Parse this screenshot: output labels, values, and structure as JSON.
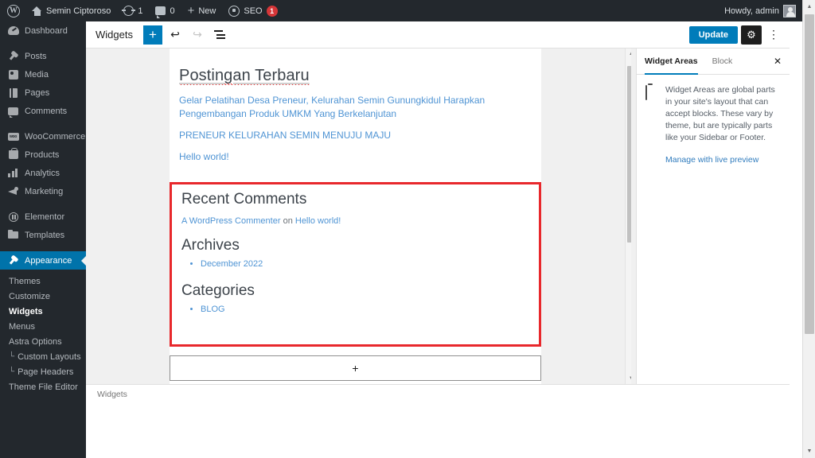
{
  "adminbar": {
    "logo_icon": "wordpress-logo-icon",
    "site_icon": "home-icon",
    "site_name": "Semin Ciptoroso",
    "updates_icon": "updates-icon",
    "updates_count": "1",
    "comments_icon": "comment-bubble-icon",
    "comments_count": "0",
    "new_icon": "plus-icon",
    "new_label": "New",
    "seo_icon": "seo-gear-icon",
    "seo_label": "SEO",
    "seo_badge": "1",
    "howdy": "Howdy, admin",
    "avatar_icon": "avatar-icon"
  },
  "adminmenu": {
    "items": [
      {
        "label": "Dashboard",
        "icon": "dashboard-icon"
      },
      {
        "label": "Posts",
        "icon": "pin-icon"
      },
      {
        "label": "Media",
        "icon": "media-icon"
      },
      {
        "label": "Pages",
        "icon": "pages-icon"
      },
      {
        "label": "Comments",
        "icon": "comment-icon"
      },
      {
        "label": "WooCommerce",
        "icon": "woocommerce-icon"
      },
      {
        "label": "Products",
        "icon": "products-bag-icon"
      },
      {
        "label": "Analytics",
        "icon": "analytics-bars-icon"
      },
      {
        "label": "Marketing",
        "icon": "megaphone-icon"
      },
      {
        "label": "Elementor",
        "icon": "elementor-icon"
      },
      {
        "label": "Templates",
        "icon": "folder-icon"
      }
    ],
    "active": {
      "label": "Appearance",
      "icon": "brush-icon"
    },
    "submenu": [
      {
        "label": "Themes",
        "current": false,
        "nested": false
      },
      {
        "label": "Customize",
        "current": false,
        "nested": false
      },
      {
        "label": "Widgets",
        "current": true,
        "nested": false
      },
      {
        "label": "Menus",
        "current": false,
        "nested": false
      },
      {
        "label": "Astra Options",
        "current": false,
        "nested": false
      },
      {
        "label": "Custom Layouts",
        "current": false,
        "nested": true
      },
      {
        "label": "Page Headers",
        "current": false,
        "nested": true
      },
      {
        "label": "Theme File Editor",
        "current": false,
        "nested": false
      }
    ],
    "nested_prefix": "└"
  },
  "toolbar": {
    "title": "Widgets",
    "add_block_icon": "plus-icon",
    "undo_icon": "undo-arrow-icon",
    "redo_icon": "redo-arrow-icon",
    "list_view_icon": "list-view-icon",
    "update_label": "Update",
    "settings_icon": "gear-icon",
    "options_icon": "vertical-ellipsis-icon"
  },
  "editor": {
    "widget_area_title": "Postingan Terbaru",
    "recent_posts": [
      "Gelar Pelatihan Desa Preneur, Kelurahan Semin Gunungkidul Harapkan Pengembangan Produk UMKM Yang Berkelanjutan",
      "PRENEUR KELURAHAN SEMIN MENUJU MAJU",
      "Hello world!"
    ],
    "selected_block": {
      "comments_heading": "Recent Comments",
      "comment_author": "A WordPress Commenter",
      "comment_on": " on ",
      "comment_post": "Hello world!",
      "archives_heading": "Archives",
      "archives_items": [
        "December 2022"
      ],
      "categories_heading": "Categories",
      "categories_items": [
        "BLOG"
      ],
      "selection_color": "#e8282c"
    },
    "appender_icon": "plus-icon",
    "breadcrumb": "Widgets"
  },
  "settings_panel": {
    "tabs": [
      {
        "label": "Widget Areas",
        "active": true
      },
      {
        "label": "Block",
        "active": false
      }
    ],
    "close_icon": "close-icon",
    "panel_icon": "widget-area-box-icon",
    "description": "Widget Areas are global parts in your site's layout that can accept blocks. These vary by theme, but are typically parts like your Sidebar or Footer.",
    "link": "Manage with live preview"
  },
  "scrollbars": {
    "up_arrow_icon": "caret-up-icon",
    "down_arrow_icon": "caret-down-icon"
  },
  "colors": {
    "wp_blue": "#007cba",
    "admin_dark": "#23282d",
    "menu_active": "#0073aa",
    "selection_red": "#e8282c",
    "link_blue": "#4f94d4",
    "badge_red": "#d63638"
  }
}
